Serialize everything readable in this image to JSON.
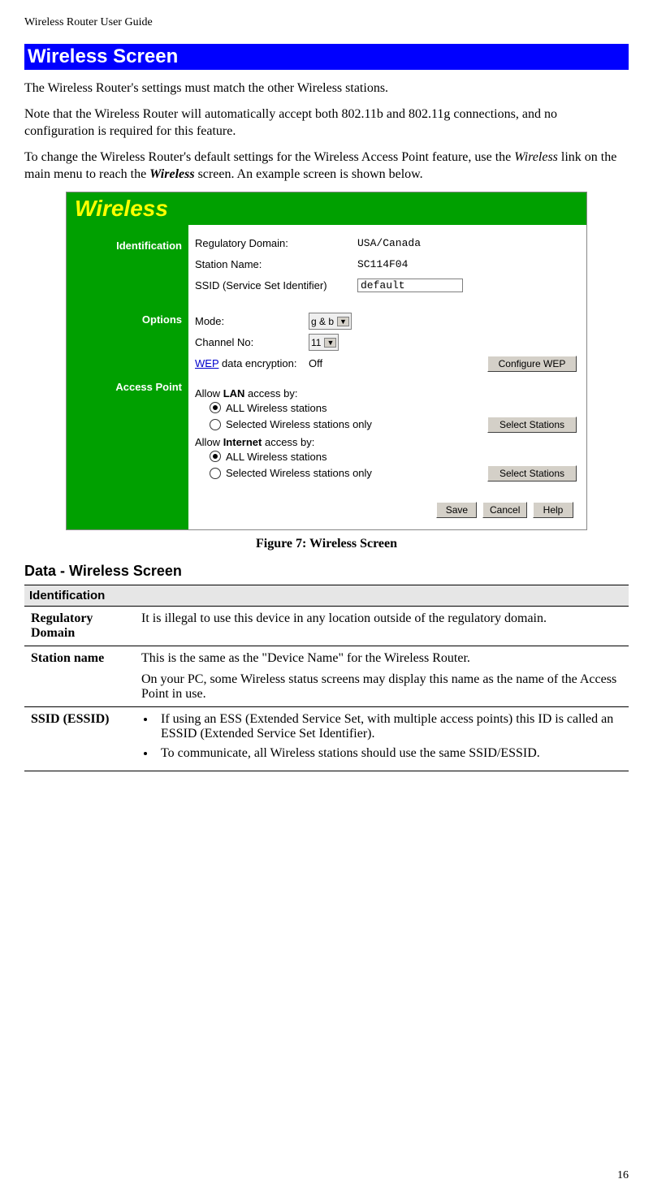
{
  "doc_header": "Wireless Router User Guide",
  "page_number": "16",
  "section_title": "Wireless Screen",
  "paragraphs": {
    "p1": "The Wireless Router's settings must match the other Wireless stations.",
    "p2": "Note that the Wireless Router will automatically accept both 802.11b and 802.11g connections, and no configuration is required for this feature.",
    "p3a": "To change the Wireless Router's default settings for the Wireless Access Point feature, use the ",
    "p3b_italic": "Wireless",
    "p3c": " link on the main menu to reach the ",
    "p3d_bold_italic": "Wireless",
    "p3e": " screen. An example screen is shown below."
  },
  "figure": {
    "title": "Wireless",
    "sidebar": {
      "identification": "Identification",
      "options": "Options",
      "access_point": "Access Point"
    },
    "identification": {
      "reg_domain_label": "Regulatory Domain:",
      "reg_domain_value": "USA/Canada",
      "station_label": "Station Name:",
      "station_value": "SC114F04",
      "ssid_label": "SSID (Service Set Identifier)",
      "ssid_value": "default"
    },
    "options": {
      "mode_label": "Mode:",
      "mode_value": "g & b",
      "channel_label": "Channel No:",
      "channel_value": "11",
      "wep_link": "WEP",
      "wep_rest": " data encryption:",
      "wep_status": "Off",
      "configure_wep_btn": "Configure WEP"
    },
    "access_point": {
      "allow_lan_prefix": "Allow ",
      "allow_lan_bold": "LAN",
      "allow_lan_suffix": " access by:",
      "radio_all": "ALL Wireless stations",
      "radio_selected": "Selected Wireless stations only",
      "select_stations_btn": "Select Stations",
      "allow_internet_prefix": "Allow ",
      "allow_internet_bold": "Internet",
      "allow_internet_suffix": " access by:"
    },
    "buttons": {
      "save": "Save",
      "cancel": "Cancel",
      "help": "Help"
    },
    "caption": "Figure 7: Wireless Screen"
  },
  "data_section": {
    "heading": "Data - Wireless Screen",
    "group_identification": "Identification",
    "rows": {
      "reg_domain": {
        "label": "Regulatory Domain",
        "text": "It is illegal to use this device in any location outside of the regulatory domain."
      },
      "station_name": {
        "label": "Station name",
        "text1": "This is the same as the \"Device Name\" for the Wireless Router.",
        "text2": "On your PC, some Wireless status screens may display this name as the name of the Access Point in use."
      },
      "ssid": {
        "label": "SSID (ESSID)",
        "bullet1": "If using an ESS (Extended Service Set, with multiple access points) this ID is called an ESSID (Extended Service Set Identifier).",
        "bullet2": "To communicate, all Wireless stations should use the same SSID/ESSID."
      }
    }
  }
}
